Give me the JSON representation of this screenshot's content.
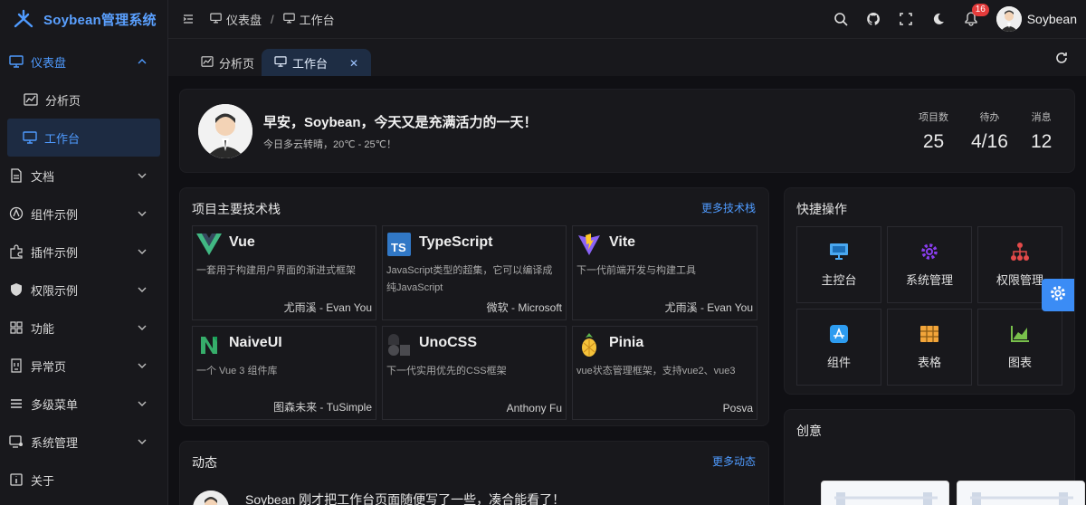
{
  "brand": {
    "name": "Soybean管理系统"
  },
  "sidebar": {
    "items": [
      {
        "label": "仪表盘",
        "icon": "dashboard-icon"
      },
      {
        "label": "分析页",
        "icon": "analysis-icon"
      },
      {
        "label": "工作台",
        "icon": "workbench-icon"
      },
      {
        "label": "文档",
        "icon": "document-icon"
      },
      {
        "label": "组件示例",
        "icon": "component-icon"
      },
      {
        "label": "插件示例",
        "icon": "plugin-icon"
      },
      {
        "label": "权限示例",
        "icon": "shield-icon"
      },
      {
        "label": "功能",
        "icon": "grid-icon"
      },
      {
        "label": "异常页",
        "icon": "exception-icon"
      },
      {
        "label": "多级菜单",
        "icon": "menu-icon"
      },
      {
        "label": "系统管理",
        "icon": "system-icon"
      },
      {
        "label": "关于",
        "icon": "info-icon"
      }
    ]
  },
  "header": {
    "breadcrumb": [
      "仪表盘",
      "工作台"
    ],
    "notification_count": "16",
    "username": "Soybean"
  },
  "tabs": [
    {
      "label": "分析页"
    },
    {
      "label": "工作台"
    }
  ],
  "welcome": {
    "greeting": "早安，Soybean，今天又是充满活力的一天！",
    "weather": "今日多云转晴，20℃ - 25℃！",
    "stats": [
      {
        "label": "项目数",
        "value": "25"
      },
      {
        "label": "待办",
        "value": "4/16"
      },
      {
        "label": "消息",
        "value": "12"
      }
    ]
  },
  "tech": {
    "title": "项目主要技术栈",
    "more": "更多技术栈",
    "items": [
      {
        "name": "Vue",
        "desc": "一套用于构建用户界面的渐进式框架",
        "author": "尤雨溪 - Evan You",
        "icon": "vue-icon"
      },
      {
        "name": "TypeScript",
        "desc": "JavaScript类型的超集，它可以编译成纯JavaScript",
        "author": "微软 - Microsoft",
        "icon": "typescript-icon"
      },
      {
        "name": "Vite",
        "desc": "下一代前端开发与构建工具",
        "author": "尤雨溪 - Evan You",
        "icon": "vite-icon"
      },
      {
        "name": "NaiveUI",
        "desc": "一个 Vue 3 组件库",
        "author": "图森未来 - TuSimple",
        "icon": "naiveui-icon"
      },
      {
        "name": "UnoCSS",
        "desc": "下一代实用优先的CSS框架",
        "author": "Anthony Fu",
        "icon": "unocss-icon"
      },
      {
        "name": "Pinia",
        "desc": "vue状态管理框架，支持vue2、vue3",
        "author": "Posva",
        "icon": "pinia-icon"
      }
    ]
  },
  "quick": {
    "title": "快捷操作",
    "items": [
      {
        "label": "主控台",
        "icon": "monitor-icon",
        "color": "#4aa8f0"
      },
      {
        "label": "系统管理",
        "icon": "gear-icon",
        "color": "#8a3ef0"
      },
      {
        "label": "权限管理",
        "icon": "hierarchy-icon",
        "color": "#e34a4a"
      },
      {
        "label": "组件",
        "icon": "app-store-icon",
        "color": "#2d9cf0"
      },
      {
        "label": "表格",
        "icon": "table-icon",
        "color": "#f2a53a"
      },
      {
        "label": "图表",
        "icon": "chart-icon",
        "color": "#78c04b"
      }
    ]
  },
  "activity": {
    "title": "动态",
    "more": "更多动态",
    "first": "Soybean 刚才把工作台页面随便写了一些，凑合能看了！"
  },
  "creative": {
    "title": "创意"
  },
  "colors": {
    "primary": "#4f9bff",
    "badge": "#e43b3b",
    "settings": "#3b8cf5"
  }
}
